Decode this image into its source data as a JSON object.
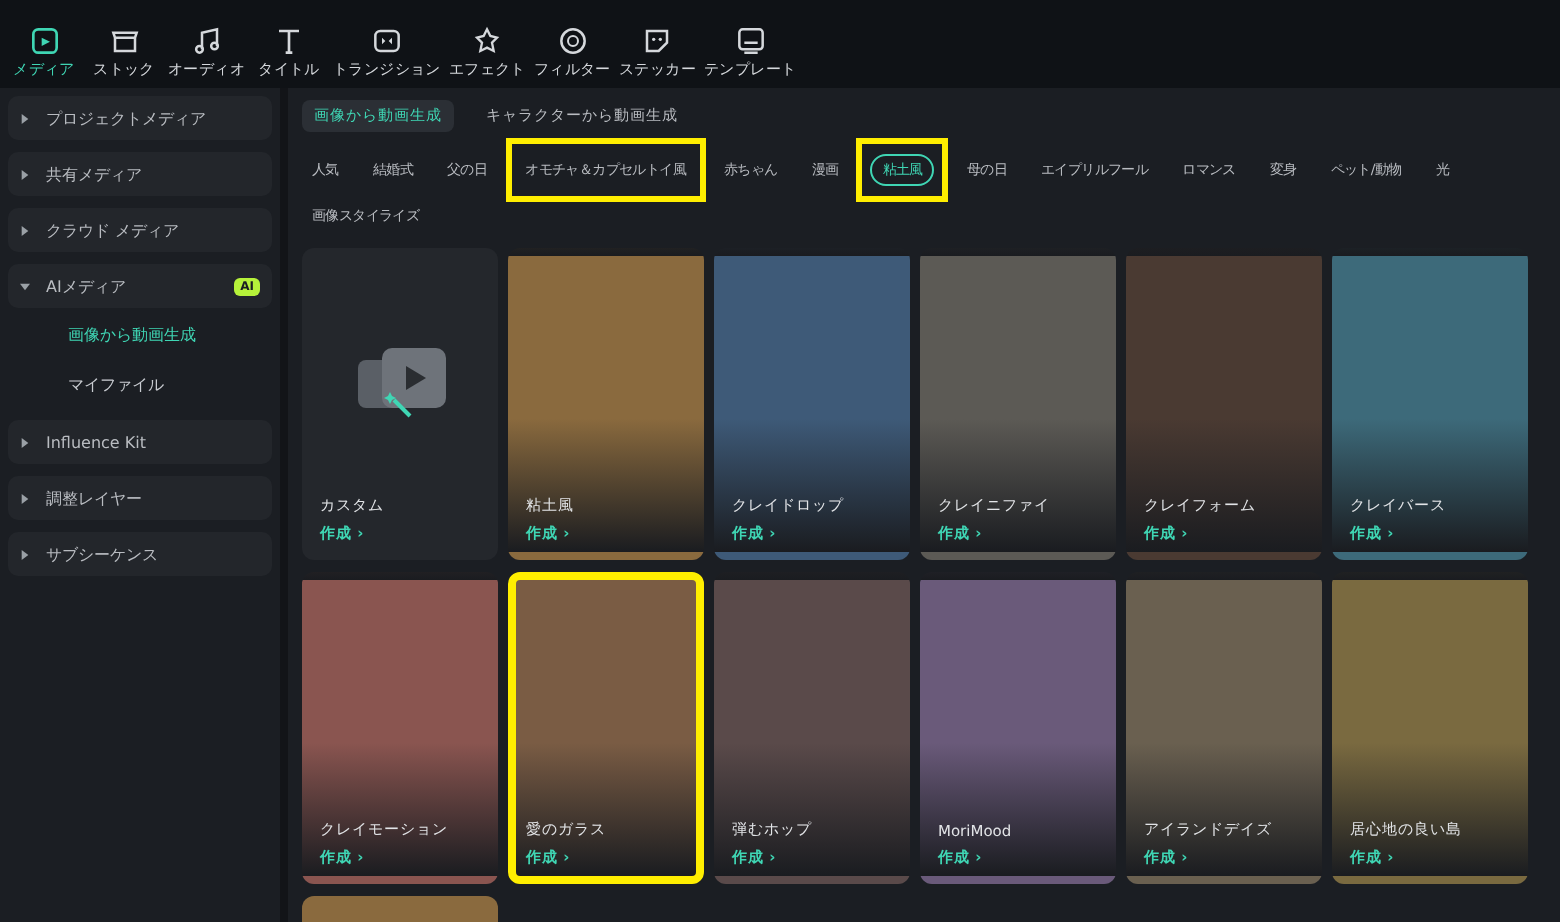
{
  "toolbar": [
    {
      "label": "メディア",
      "selected": true
    },
    {
      "label": "ストック",
      "selected": false
    },
    {
      "label": "オーディオ",
      "selected": false
    },
    {
      "label": "タイトル",
      "selected": false
    },
    {
      "label": "トランジション",
      "selected": false
    },
    {
      "label": "エフェクト",
      "selected": false
    },
    {
      "label": "フィルター",
      "selected": false
    },
    {
      "label": "ステッカー",
      "selected": false
    },
    {
      "label": "テンプレート",
      "selected": false
    }
  ],
  "sidebar": {
    "items": [
      {
        "label": "プロジェクトメディア",
        "expanded": false
      },
      {
        "label": "共有メディア",
        "expanded": false
      },
      {
        "label": "クラウド メディア",
        "expanded": false
      },
      {
        "label": "AIメディア",
        "expanded": true,
        "badge": "AI",
        "children": [
          {
            "label": "画像から動画生成",
            "selected": true
          },
          {
            "label": "マイファイル",
            "selected": false
          }
        ]
      },
      {
        "label": "Influence Kit",
        "expanded": false
      },
      {
        "label": "調整レイヤー",
        "expanded": false
      },
      {
        "label": "サブシーケンス",
        "expanded": false
      }
    ]
  },
  "tabs": [
    {
      "label": "画像から動画生成",
      "selected": true
    },
    {
      "label": "キャラクターから動画生成",
      "selected": false
    }
  ],
  "categories": [
    {
      "label": "人気",
      "selected": false,
      "highlighted": false
    },
    {
      "label": "結婚式",
      "selected": false,
      "highlighted": false
    },
    {
      "label": "父の日",
      "selected": false,
      "highlighted": false
    },
    {
      "label": "オモチャ＆カプセルトイ風",
      "selected": false,
      "highlighted": true
    },
    {
      "label": "赤ちゃん",
      "selected": false,
      "highlighted": false
    },
    {
      "label": "漫画",
      "selected": false,
      "highlighted": false
    },
    {
      "label": "粘土風",
      "selected": true,
      "highlighted": true
    },
    {
      "label": "母の日",
      "selected": false,
      "highlighted": false
    },
    {
      "label": "エイプリルフール",
      "selected": false,
      "highlighted": false
    },
    {
      "label": "ロマンス",
      "selected": false,
      "highlighted": false
    },
    {
      "label": "変身",
      "selected": false,
      "highlighted": false
    },
    {
      "label": "ペット/動物",
      "selected": false,
      "highlighted": false
    },
    {
      "label": "光",
      "selected": false,
      "highlighted": false
    }
  ],
  "categories_row_2": [
    {
      "label": "画像スタイライズ",
      "selected": false,
      "highlighted": false
    }
  ],
  "cards": [
    {
      "kind": "custom",
      "title": "カスタム",
      "action": "作成 ›",
      "highlighted": false
    },
    {
      "kind": "photo",
      "title": "粘土風",
      "action": "作成 ›",
      "highlighted": false
    },
    {
      "kind": "photo",
      "title": "クレイドロップ",
      "action": "作成 ›",
      "highlighted": false
    },
    {
      "kind": "photo",
      "title": "クレイニファイ",
      "action": "作成 ›",
      "highlighted": false
    },
    {
      "kind": "photo",
      "title": "クレイフォーム",
      "action": "作成 ›",
      "highlighted": false
    },
    {
      "kind": "photo",
      "title": "クレイバース",
      "action": "作成 ›",
      "highlighted": false
    },
    {
      "kind": "photo",
      "title": "クレイモーション",
      "action": "作成 ›",
      "highlighted": false
    },
    {
      "kind": "photo",
      "title": "愛のガラス",
      "action": "作成 ›",
      "highlighted": true
    },
    {
      "kind": "photo",
      "title": "弾むホップ",
      "action": "作成 ›",
      "highlighted": false
    },
    {
      "kind": "photo",
      "title": "MoriMood",
      "action": "作成 ›",
      "highlighted": false
    },
    {
      "kind": "photo",
      "title": "アイランドデイズ",
      "action": "作成 ›",
      "highlighted": false
    },
    {
      "kind": "photo",
      "title": "居心地の良い島",
      "action": "作成 ›",
      "highlighted": false
    },
    {
      "kind": "partial"
    }
  ]
}
